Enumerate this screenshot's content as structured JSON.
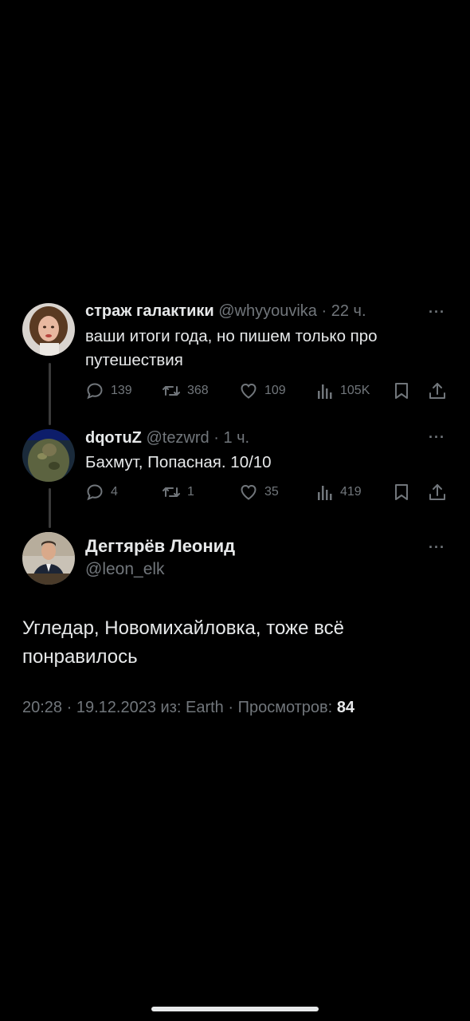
{
  "replies": [
    {
      "name": "страж галактики",
      "handle": "@whyyouvika",
      "time": "· 22 ч.",
      "text": "ваши итоги года, но пишем только про путешествия",
      "stats": {
        "replies": "139",
        "retweets": "368",
        "likes": "109",
        "views": "105K"
      }
    },
    {
      "name": "dqoтuZ",
      "handle": "@tezwrd",
      "time": "· 1 ч.",
      "text": "Бахмут, Попасная. 10/10",
      "stats": {
        "replies": "4",
        "retweets": "1",
        "likes": "35",
        "views": "419"
      }
    }
  ],
  "main": {
    "name": "Дегтярёв Леонид",
    "handle": "@leon_elk",
    "text": "Угледар, Новомихайловка, тоже всё понравилось",
    "time": "20:28",
    "date": "19.12.2023",
    "source": "из: Earth",
    "views_label": "Просмотров:",
    "views": "84"
  },
  "more_label": "···",
  "sep": "·",
  "icons": {
    "reply": "reply-icon",
    "retweet": "retweet-icon",
    "like": "heart-icon",
    "views": "views-icon",
    "bookmark": "bookmark-icon",
    "share": "share-icon"
  },
  "colors": {
    "background": "#000000",
    "text": "#e7e9ea",
    "muted": "#71767b"
  }
}
